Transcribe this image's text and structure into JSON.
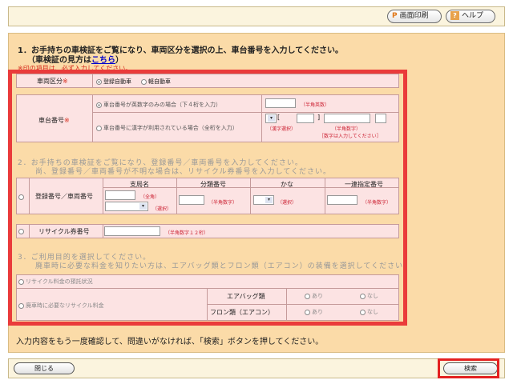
{
  "header": {
    "print_label": "画面印刷",
    "print_icon": "P",
    "help_label": "ヘルプ",
    "help_icon": "?"
  },
  "section1": {
    "title": "1．お手持ちの車検証をご覧になり、車両区分を選択の上、車台番号を入力してください。",
    "subtitle_prefix": "（車検証の見方は",
    "subtitle_link": "こちら",
    "subtitle_suffix": "）",
    "required_note": "※印の項目は、必ず入力してください。",
    "vehicle_type_label": "車両区分",
    "vehicle_type_options": [
      "登録自動車",
      "軽自動車"
    ],
    "chassis_label": "車台番号",
    "chassis_option1": "車台番号が英数字のみの場合（下４桁を入力）",
    "chassis_option1_note": "（半角英数）",
    "chassis_option2": "車台番号に漢字が利用されている場合（全桁を入力）",
    "chassis_option2_note1": "（漢字選択）",
    "chassis_option2_note2": "（半角数字）",
    "chassis_option2_note3": "［数字は入力してください］",
    "bracket_open": "[",
    "bracket_close": "]",
    "required_mark": "※"
  },
  "section2": {
    "title": "2．お手持ちの車検証をご覧になり、登録番号／車両番号を入力してください。",
    "subtitle": "尚、登録番号／車両番号が不明な場合は、リサイクル券番号を入力してください。",
    "reg_label": "登録番号／車両番号",
    "col_headers": [
      "支局名",
      "分類番号",
      "かな",
      "一連指定番号"
    ],
    "branch_note1": "（全角）",
    "branch_note2": "（選択）",
    "class_note": "（半角数字）",
    "kana_note": "（選択）",
    "serial_note": "（半角数字）",
    "recycle_label": "リサイクル券番号",
    "recycle_note": "（半角数字１２桁）"
  },
  "section3": {
    "title": "3．ご利用目的を選択してください。",
    "subtitle": "廃車時に必要な料金を知りたい方は、エアバッグ類とフロン類（エアコン）の装備を選択してください。",
    "option1": "リサイクル料金の預託状況",
    "option2": "廃車時に必要なリサイクル料金",
    "airbag_label": "エアバッグ類",
    "freon_label": "フロン類（エアコン）",
    "yes": "あり",
    "no": "なし"
  },
  "confirm_text": "入力内容をもう一度確認して、問違いがなければ、「検索」ボタンを押してください。",
  "footer": {
    "close_label": "閉じる",
    "search_label": "検索"
  }
}
